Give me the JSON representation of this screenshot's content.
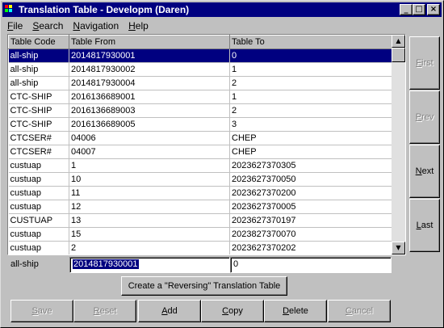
{
  "window": {
    "title": "Translation Table - Developm (Daren)",
    "controls": {
      "minimize": "_",
      "maximize": "□",
      "close": "×"
    }
  },
  "menu": [
    {
      "label": "File",
      "accel": "F",
      "rest": "ile"
    },
    {
      "label": "Search",
      "accel": "S",
      "rest": "earch"
    },
    {
      "label": "Navigation",
      "accel": "N",
      "rest": "avigation"
    },
    {
      "label": "Help",
      "accel": "H",
      "rest": "elp"
    }
  ],
  "grid": {
    "columns": [
      "Table Code",
      "Table From",
      "Table To"
    ],
    "rows": [
      [
        "all-ship",
        "2014817930001",
        "0"
      ],
      [
        "all-ship",
        "2014817930002",
        "1"
      ],
      [
        "all-ship",
        "2014817930004",
        "2"
      ],
      [
        "CTC-SHIP",
        "2016136689001",
        "1"
      ],
      [
        "CTC-SHIP",
        "2016136689003",
        "2"
      ],
      [
        "CTC-SHIP",
        "2016136689005",
        "3"
      ],
      [
        "CTCSER#",
        "04006",
        "CHEP"
      ],
      [
        "CTCSER#",
        "04007",
        "CHEP"
      ],
      [
        "custuap",
        "1",
        "2023627370305"
      ],
      [
        "custuap",
        "10",
        "2023627370050"
      ],
      [
        "custuap",
        "11",
        "2023627370200"
      ],
      [
        "custuap",
        "12",
        "2023627370005"
      ],
      [
        "CUSTUAP",
        "13",
        "2023627370197"
      ],
      [
        "custuap",
        "15",
        "2023827370070"
      ],
      [
        "custuap",
        "2",
        "2023627370202"
      ]
    ],
    "selected_row": 0
  },
  "edit": {
    "code": "all-ship",
    "from": "2014817930001",
    "to": "0"
  },
  "reverse_button": {
    "label": "Create a \"Reversing\" Translation Table"
  },
  "bottom_buttons": [
    {
      "label": "Save",
      "accel": "S",
      "rest": "ave",
      "enabled": false
    },
    {
      "label": "Reset",
      "accel": "R",
      "rest": "eset",
      "enabled": false
    },
    {
      "label": "Add",
      "accel": "A",
      "rest": "dd",
      "enabled": true
    },
    {
      "label": "Copy",
      "accel": "C",
      "rest": "opy",
      "enabled": true
    },
    {
      "label": "Delete",
      "accel": "D",
      "rest": "elete",
      "enabled": true
    },
    {
      "label": "Cancel",
      "accel": "C",
      "rest": "ancel",
      "enabled": false
    }
  ],
  "nav_buttons": [
    {
      "label": "First",
      "accel": "F",
      "rest": "irst",
      "enabled": false
    },
    {
      "label": "Prev",
      "accel": "P",
      "rest": "rev",
      "enabled": false
    },
    {
      "label": "Next",
      "accel": "N",
      "rest": "ext",
      "enabled": true
    },
    {
      "label": "Last",
      "accel": "L",
      "rest": "ast",
      "enabled": true
    }
  ],
  "scrollbar": {
    "up_icon": "arrow-up-icon",
    "down_icon": "arrow-down-icon"
  },
  "colors": {
    "title_bar": "#000080",
    "selection": "#000080",
    "face": "#c0c0c0"
  }
}
